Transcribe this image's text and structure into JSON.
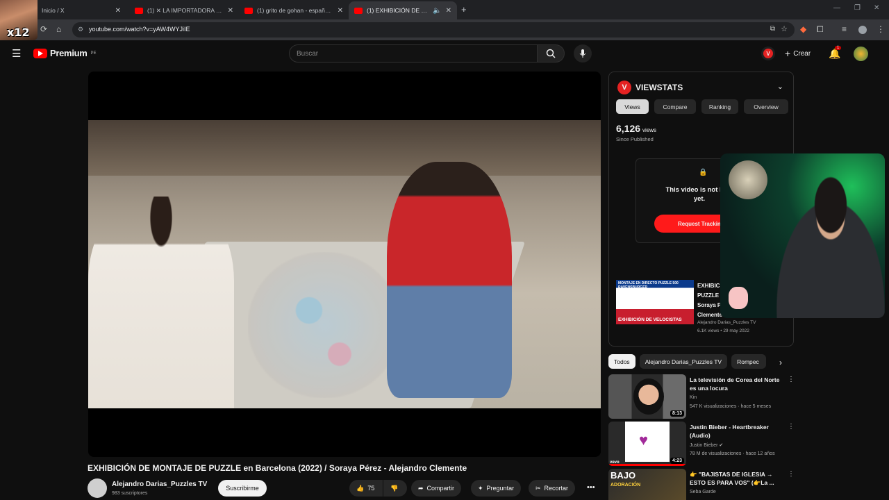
{
  "browser": {
    "tabs": [
      {
        "title": "Inicio / X",
        "favicon": "x-logo-icon"
      },
      {
        "title": "(1) ✕ LA IMPORTADORA MÁS",
        "favicon": "youtube-icon"
      },
      {
        "title": "(1) grito de gohan - español e",
        "favicon": "youtube-icon"
      },
      {
        "title": "(1) EXHIBICIÓN DE MONTA",
        "favicon": "youtube-icon",
        "active": true
      }
    ],
    "url": "youtube.com/watch?v=yAW4WYJiIE",
    "overlay_label": "x12"
  },
  "yt": {
    "logo": "Premium",
    "logo_region": "PE",
    "search_placeholder": "Buscar",
    "create_label": "Crear",
    "notif_count": "1"
  },
  "video": {
    "title": "EXHIBICIÓN DE MONTAJE DE PUZZLE en Barcelona (2022) / Soraya Pérez - Alejandro Clemente",
    "channel": "Alejandro Darias_Puzzles TV",
    "subscribers": "983 suscriptores",
    "subscribe_label": "Suscribirme",
    "likes": "75",
    "share_label": "Compartir",
    "ask_label": "Preguntar",
    "clip_label": "Recortar"
  },
  "viewstats": {
    "title": "VIEWSTATS",
    "tabs": [
      "Views",
      "Compare",
      "Ranking",
      "Overview"
    ],
    "views_count": "6,126",
    "views_unit": "views",
    "since": "Since Published",
    "notice": "This video is not bein yet.",
    "notice_line1": "This video is not bein",
    "notice_line2": "yet.",
    "request_label": "Request Trackin",
    "card": {
      "thumb_top": "MONTAJE EN DIRECTO PUZZLE 500 RAVENSBURGER",
      "thumb_bottom": "EXHIBICIÓN DE VELOCISTAS",
      "title": "EXHIBIC PUZZLE Soraya Pé Clemente",
      "title_lines": [
        "EXHIBIC",
        "PUZZLE",
        "Soraya Pé",
        "Clemente"
      ],
      "channel": "Alejandro Darias_Puzzles TV",
      "meta": "6.1K views • 29 may 2022"
    }
  },
  "chips": [
    "Todos",
    "Alejandro Darias_Puzzles TV",
    "Rompec"
  ],
  "recommendations": [
    {
      "title": "La televisión de Corea del Norte es una locura",
      "channel": "Kin",
      "meta": "547 K visualizaciones · hace 5 meses",
      "duration": "8:13",
      "thumb_color": "#3b3b3b"
    },
    {
      "title": "Justin Bieber - Heartbreaker (Audio)",
      "channel": "Justin Bieber",
      "meta": "78 M de visualizaciones · hace 12 años",
      "duration": "4:23",
      "thumb_color": "#ffffff"
    },
    {
      "title": "👉 \"BAJISTAS DE IGLESIA → ESTO ES PARA VOS\" (👉La ...",
      "channel": "Seba Garde",
      "meta": "",
      "duration": "",
      "thumb_color": "#1f1f1f"
    }
  ]
}
